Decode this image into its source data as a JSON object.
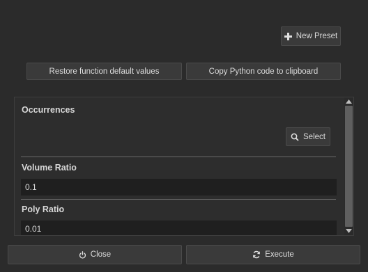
{
  "toolbar": {
    "new_preset_label": "New Preset",
    "new_preset_icon": "plus-icon"
  },
  "actions": {
    "restore_label": "Restore function default values",
    "copy_label": "Copy Python code to clipboard"
  },
  "params": {
    "occurrences": {
      "title": "Occurrences",
      "select_label": "Select",
      "select_icon": "search-icon"
    },
    "volume_ratio": {
      "title": "Volume Ratio",
      "value": "0.1"
    },
    "poly_ratio": {
      "title": "Poly Ratio",
      "value": "0.01"
    }
  },
  "footer": {
    "close_label": "Close",
    "close_icon": "power-icon",
    "execute_label": "Execute",
    "execute_icon": "refresh-icon"
  },
  "colors": {
    "background": "#2b2b2b",
    "button": "#3a3a3a",
    "field": "#1f1f1f",
    "text": "#d6d6d6"
  }
}
